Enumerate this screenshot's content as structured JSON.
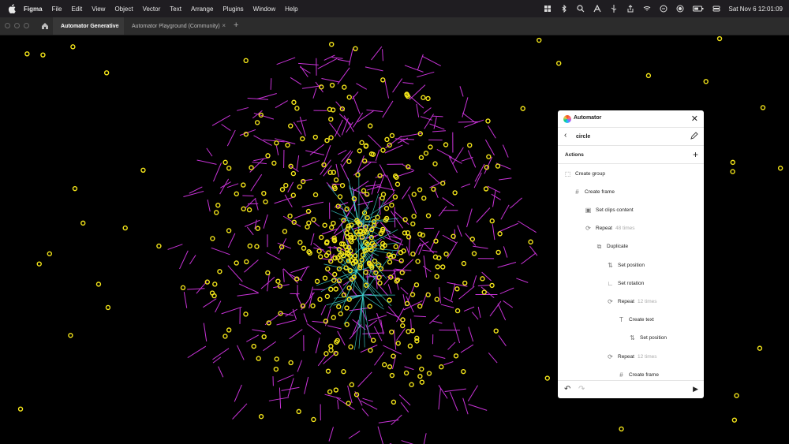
{
  "menubar": {
    "app": "Figma",
    "items": [
      "File",
      "Edit",
      "View",
      "Object",
      "Vector",
      "Text",
      "Arrange",
      "Plugins",
      "Window",
      "Help"
    ],
    "clock": "Sat Nov 6  12:01:09"
  },
  "tabs": [
    {
      "label": "Automator Generative",
      "active": true
    },
    {
      "label": "Automator Playground (Community)",
      "active": false
    }
  ],
  "colors": {
    "circle": "#f5e61a",
    "line": "#c933d8",
    "web": "#3fd9d4",
    "canvas": "#000000"
  },
  "panel": {
    "title": "Automator",
    "name": "circle",
    "actions_label": "Actions",
    "rows": [
      {
        "icon": "dashed-square-icon",
        "label": "Create group",
        "meta": ""
      },
      {
        "icon": "hash-icon",
        "label": "Create frame",
        "meta": ""
      },
      {
        "icon": "clip-icon",
        "label": "Set clips content",
        "meta": ""
      },
      {
        "icon": "repeat-icon",
        "label": "Repeat",
        "meta": "48 times"
      },
      {
        "icon": "duplicate-icon",
        "label": "Duplicate",
        "meta": ""
      },
      {
        "icon": "position-icon",
        "label": "Set position",
        "meta": ""
      },
      {
        "icon": "angle-icon",
        "label": "Set rotation",
        "meta": ""
      },
      {
        "icon": "repeat-icon",
        "label": "Repeat",
        "meta": "12 times"
      },
      {
        "icon": "text-icon",
        "label": "Create text",
        "meta": ""
      },
      {
        "icon": "position-icon",
        "label": "Set position",
        "meta": ""
      },
      {
        "icon": "repeat-icon",
        "label": "Repeat",
        "meta": "12 times"
      },
      {
        "icon": "hash-icon",
        "label": "Create frame",
        "meta": ""
      }
    ]
  }
}
